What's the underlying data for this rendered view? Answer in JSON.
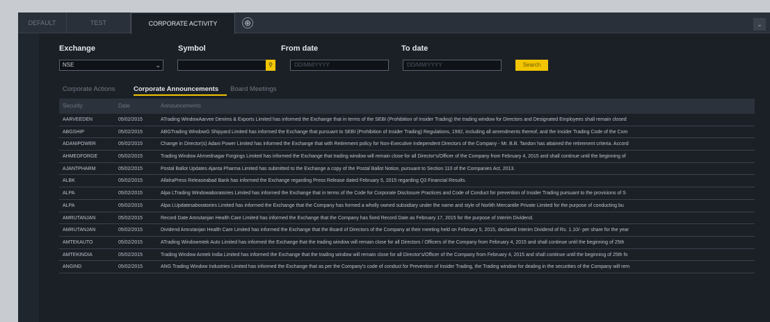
{
  "tabs": {
    "default": "DEFAULT",
    "test": "TEST",
    "active": "CORPORATE ACTIVITY",
    "add": "⊕",
    "collapse": "⌄"
  },
  "filters": {
    "exchange_label": "Exchange",
    "exchange_value": "NSE",
    "symbol_label": "Symbol",
    "symbol_value": "",
    "from_label": "From date",
    "from_placeholder": "DD/MM/YYYY",
    "to_label": "To date",
    "to_placeholder": "DD/MM/YYYY",
    "search_label": "Search"
  },
  "subtabs": [
    "Corporate Actions",
    "Corporate Announcements",
    "Board Meetings"
  ],
  "table": {
    "headers": [
      "Security",
      "Date",
      "Announcements"
    ],
    "rows": [
      [
        "AARVEEDEN",
        "05/02/2015",
        "ATrading WindowAarvee Denims & Exports Limited has informed the Exchange that in terms of the SEBI (Prohibition of Insider Trading) the trading window for Directors and Designated Employees shall remain closed"
      ],
      [
        "ABGSHIP",
        "05/02/2015",
        "ABGTrading WindowG Shipyard Limited has informed the Exchange that pursuant to SEBI (Prohibition of Insider Trading) Regulations, 1992, including all amendments thereof, and the Insider Trading Code of the Com"
      ],
      [
        "ADANIPOWER",
        "05/02/2015",
        "Change in Director(s) Adani Power Limited has informed the Exchange that with Retirement policy for Non-Executive Independent Directors of the Company - Mr. B.B. Tandon has attained the retirement criteria. Accord"
      ],
      [
        "AHMEDFORGE",
        "05/02/2015",
        "Trading Window Ahmednagar Forgings Limited has informed the Exchange that trading window will remain close for all Director's/Officer of the Company from February 4, 2015 and shall continue until the beginning of"
      ],
      [
        "AJANTPHARM",
        "05/02/2015",
        "Postal Ballot Updates Ajanta Pharma Limited has submitted to the Exchange a copy of the Postal Ballot Notice, pursuant to Section 110 of the Companies Act, 2013."
      ],
      [
        "ALBK",
        "05/02/2015",
        "AllahaPress Releaseabad Bank has informed the Exchange regarding Press Release dated February 5, 2015 regarding Q3 Financial Results."
      ],
      [
        "ALPA",
        "05/02/2015",
        "Alpa LTrading Windowaboratories Limited has informed the Exchange that in terms of the Code for Corporate Disclosure Practices and Code of Conduct for prevention of Insider Trading pursuant to the provisions of S"
      ],
      [
        "ALPA",
        "05/02/2015",
        "Alpa LUpdatesaboratories Limited has informed the Exchange that the Company has formed a wholly owned subsidiary under the name and style of Norlith Mercantile Private Limited for the purpose of conducting bu"
      ],
      [
        "AMRUTANJAN",
        "05/02/2015",
        "Record Date Amrutanjan Health Care Limited has informed the Exchange that the Company has fixed Record Date as February 17, 2015 for the purpose of Interim Dividend."
      ],
      [
        "AMRUTANJAN",
        "05/02/2015",
        "Dividend Amrutanjan Health Care Limited has informed the Exchange that the Board of Directors of the Company at their meeting held on February 5, 2015, declared Interim Dividend of Rs. 1.10/- per share for the year"
      ],
      [
        "AMTEKAUTO",
        "05/02/2015",
        "ATrading Windowmtek Auto Limited has informed the Exchange that the trading window will remain close for all Directors / Officers of the Company from February 4, 2015 and shall continue until the beginning of 25th"
      ],
      [
        "AMTEKINDIA",
        "05/02/2015",
        "Trading Window Amtek India Limited has informed the Exchange that the trading window will remain close for all Director's/Officer of the Company from February 4, 2015 and shall continue until the beginning of 25th fo"
      ],
      [
        "ANGIND",
        "05/02/2015",
        "ANG Trading Window Industries Limited has informed the Exchange that as per the Company's code of conduct for Prevention of Insider Trading, the Trading window for dealing in the securities of the Company will rem"
      ]
    ]
  }
}
